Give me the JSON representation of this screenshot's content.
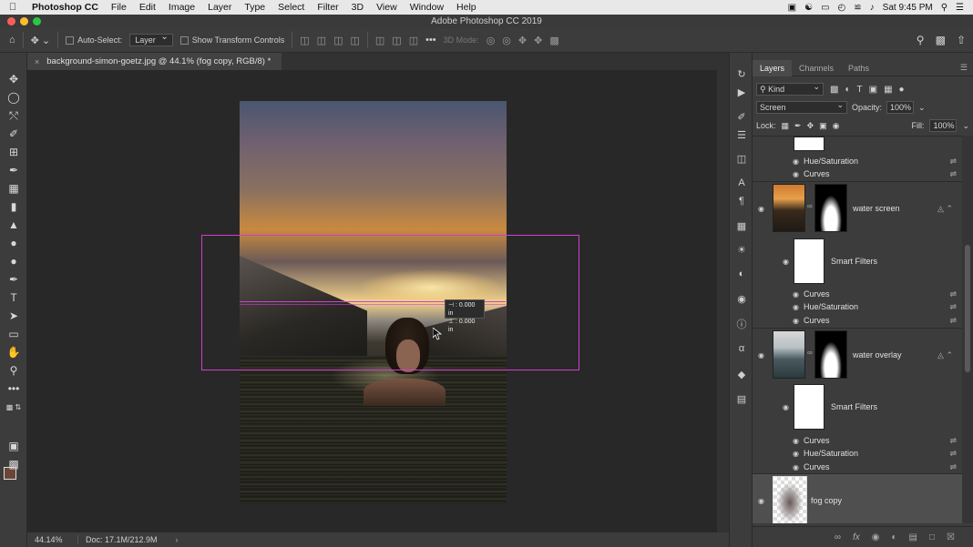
{
  "menubar": {
    "items": [
      "Photoshop CC",
      "File",
      "Edit",
      "Image",
      "Layer",
      "Type",
      "Select",
      "Filter",
      "3D",
      "View",
      "Window",
      "Help"
    ],
    "clock": "Sat 9:45 PM"
  },
  "window": {
    "title": "Adobe Photoshop CC 2019"
  },
  "options": {
    "auto_select_label": "Auto-Select:",
    "auto_select_target": "Layer",
    "transform_controls_label": "Show Transform Controls",
    "mode_3d_label": "3D Mode:"
  },
  "document": {
    "tab_title": "background-simon-goetz.jpg @ 44.1% (fog copy, RGB/8) *"
  },
  "readout": {
    "line1": "⊣ : 0.000 in",
    "line2": "⊥ : 0.000 in"
  },
  "status": {
    "zoom": "44.14%",
    "doc": "Doc: 17.1M/212.9M",
    "arrow": "›"
  },
  "layers_panel": {
    "tabs": [
      "Layers",
      "Channels",
      "Paths"
    ],
    "active_tab": "Layers",
    "filter_kind": "Kind",
    "blend_mode": "Screen",
    "opacity_label": "Opacity:",
    "opacity": "100%",
    "lock_label": "Lock:",
    "fill_label": "Fill:",
    "fill": "100%",
    "effects": {
      "top_hue": "Hue/Saturation",
      "top_curves": "Curves",
      "ws_smart": "Smart Filters",
      "ws_curves1": "Curves",
      "ws_hue": "Hue/Saturation",
      "ws_curves2": "Curves",
      "wo_smart": "Smart Filters",
      "wo_curves1": "Curves",
      "wo_hue": "Hue/Saturation",
      "wo_curves2": "Curves"
    },
    "layers": {
      "water_screen": "water screen",
      "water_overlay": "water overlay",
      "fog_copy": "fog copy"
    }
  },
  "colors": {
    "foreground": "#6a4638",
    "background": "#ffffff",
    "guide": "#d43cd0",
    "panel_bg": "#3c3c3c"
  }
}
